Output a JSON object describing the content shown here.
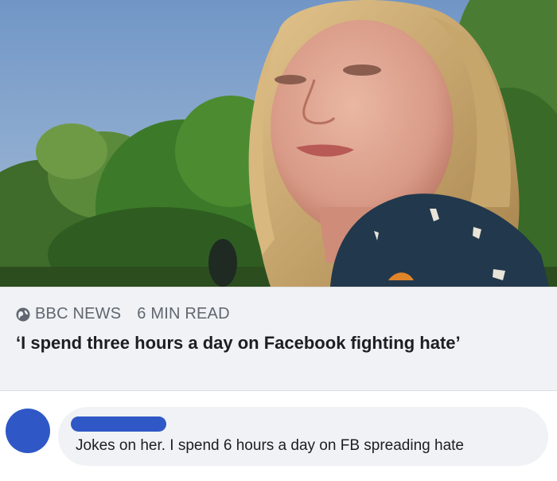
{
  "post_image": {
    "alt": "Photo of a woman with blonde hair outdoors in front of trees"
  },
  "link_preview": {
    "source": "BBC NEWS",
    "read_time": "6 MIN READ",
    "headline": "‘I spend three hours a day on Facebook fighting hate’",
    "source_icon": "globe-icon"
  },
  "comment": {
    "author_redacted": true,
    "text": "Jokes on her. I spend 6 hours a day on FB spreading hate"
  },
  "colors": {
    "avatar": "#2f58c6",
    "card_bg": "#f0f2f5",
    "meta_text": "#606770",
    "text": "#1c1e21"
  }
}
